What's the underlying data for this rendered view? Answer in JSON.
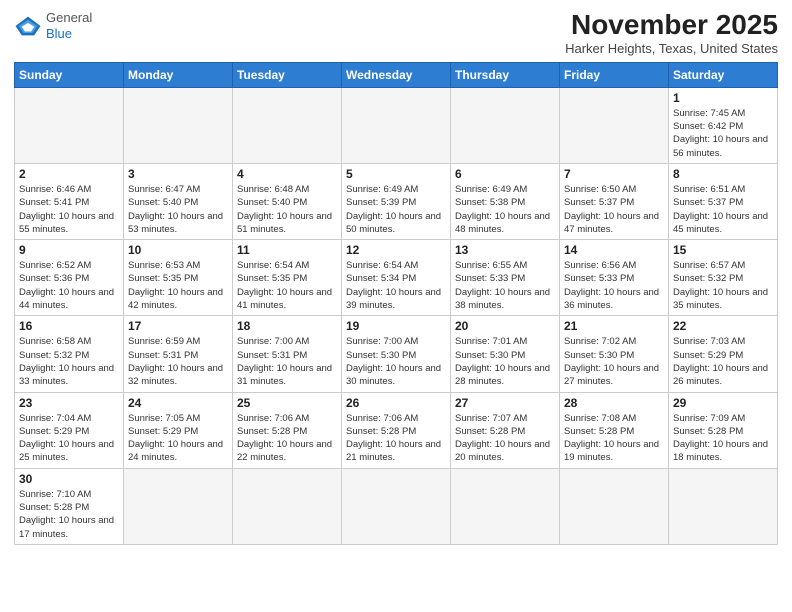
{
  "header": {
    "logo_general": "General",
    "logo_blue": "Blue",
    "month": "November 2025",
    "location": "Harker Heights, Texas, United States"
  },
  "weekdays": [
    "Sunday",
    "Monday",
    "Tuesday",
    "Wednesday",
    "Thursday",
    "Friday",
    "Saturday"
  ],
  "weeks": [
    [
      {
        "day": "",
        "info": ""
      },
      {
        "day": "",
        "info": ""
      },
      {
        "day": "",
        "info": ""
      },
      {
        "day": "",
        "info": ""
      },
      {
        "day": "",
        "info": ""
      },
      {
        "day": "",
        "info": ""
      },
      {
        "day": "1",
        "info": "Sunrise: 7:45 AM\nSunset: 6:42 PM\nDaylight: 10 hours and 56 minutes."
      }
    ],
    [
      {
        "day": "2",
        "info": "Sunrise: 6:46 AM\nSunset: 5:41 PM\nDaylight: 10 hours and 55 minutes."
      },
      {
        "day": "3",
        "info": "Sunrise: 6:47 AM\nSunset: 5:40 PM\nDaylight: 10 hours and 53 minutes."
      },
      {
        "day": "4",
        "info": "Sunrise: 6:48 AM\nSunset: 5:40 PM\nDaylight: 10 hours and 51 minutes."
      },
      {
        "day": "5",
        "info": "Sunrise: 6:49 AM\nSunset: 5:39 PM\nDaylight: 10 hours and 50 minutes."
      },
      {
        "day": "6",
        "info": "Sunrise: 6:49 AM\nSunset: 5:38 PM\nDaylight: 10 hours and 48 minutes."
      },
      {
        "day": "7",
        "info": "Sunrise: 6:50 AM\nSunset: 5:37 PM\nDaylight: 10 hours and 47 minutes."
      },
      {
        "day": "8",
        "info": "Sunrise: 6:51 AM\nSunset: 5:37 PM\nDaylight: 10 hours and 45 minutes."
      }
    ],
    [
      {
        "day": "9",
        "info": "Sunrise: 6:52 AM\nSunset: 5:36 PM\nDaylight: 10 hours and 44 minutes."
      },
      {
        "day": "10",
        "info": "Sunrise: 6:53 AM\nSunset: 5:35 PM\nDaylight: 10 hours and 42 minutes."
      },
      {
        "day": "11",
        "info": "Sunrise: 6:54 AM\nSunset: 5:35 PM\nDaylight: 10 hours and 41 minutes."
      },
      {
        "day": "12",
        "info": "Sunrise: 6:54 AM\nSunset: 5:34 PM\nDaylight: 10 hours and 39 minutes."
      },
      {
        "day": "13",
        "info": "Sunrise: 6:55 AM\nSunset: 5:33 PM\nDaylight: 10 hours and 38 minutes."
      },
      {
        "day": "14",
        "info": "Sunrise: 6:56 AM\nSunset: 5:33 PM\nDaylight: 10 hours and 36 minutes."
      },
      {
        "day": "15",
        "info": "Sunrise: 6:57 AM\nSunset: 5:32 PM\nDaylight: 10 hours and 35 minutes."
      }
    ],
    [
      {
        "day": "16",
        "info": "Sunrise: 6:58 AM\nSunset: 5:32 PM\nDaylight: 10 hours and 33 minutes."
      },
      {
        "day": "17",
        "info": "Sunrise: 6:59 AM\nSunset: 5:31 PM\nDaylight: 10 hours and 32 minutes."
      },
      {
        "day": "18",
        "info": "Sunrise: 7:00 AM\nSunset: 5:31 PM\nDaylight: 10 hours and 31 minutes."
      },
      {
        "day": "19",
        "info": "Sunrise: 7:00 AM\nSunset: 5:30 PM\nDaylight: 10 hours and 30 minutes."
      },
      {
        "day": "20",
        "info": "Sunrise: 7:01 AM\nSunset: 5:30 PM\nDaylight: 10 hours and 28 minutes."
      },
      {
        "day": "21",
        "info": "Sunrise: 7:02 AM\nSunset: 5:30 PM\nDaylight: 10 hours and 27 minutes."
      },
      {
        "day": "22",
        "info": "Sunrise: 7:03 AM\nSunset: 5:29 PM\nDaylight: 10 hours and 26 minutes."
      }
    ],
    [
      {
        "day": "23",
        "info": "Sunrise: 7:04 AM\nSunset: 5:29 PM\nDaylight: 10 hours and 25 minutes."
      },
      {
        "day": "24",
        "info": "Sunrise: 7:05 AM\nSunset: 5:29 PM\nDaylight: 10 hours and 24 minutes."
      },
      {
        "day": "25",
        "info": "Sunrise: 7:06 AM\nSunset: 5:28 PM\nDaylight: 10 hours and 22 minutes."
      },
      {
        "day": "26",
        "info": "Sunrise: 7:06 AM\nSunset: 5:28 PM\nDaylight: 10 hours and 21 minutes."
      },
      {
        "day": "27",
        "info": "Sunrise: 7:07 AM\nSunset: 5:28 PM\nDaylight: 10 hours and 20 minutes."
      },
      {
        "day": "28",
        "info": "Sunrise: 7:08 AM\nSunset: 5:28 PM\nDaylight: 10 hours and 19 minutes."
      },
      {
        "day": "29",
        "info": "Sunrise: 7:09 AM\nSunset: 5:28 PM\nDaylight: 10 hours and 18 minutes."
      }
    ],
    [
      {
        "day": "30",
        "info": "Sunrise: 7:10 AM\nSunset: 5:28 PM\nDaylight: 10 hours and 17 minutes."
      },
      {
        "day": "",
        "info": ""
      },
      {
        "day": "",
        "info": ""
      },
      {
        "day": "",
        "info": ""
      },
      {
        "day": "",
        "info": ""
      },
      {
        "day": "",
        "info": ""
      },
      {
        "day": "",
        "info": ""
      }
    ]
  ]
}
